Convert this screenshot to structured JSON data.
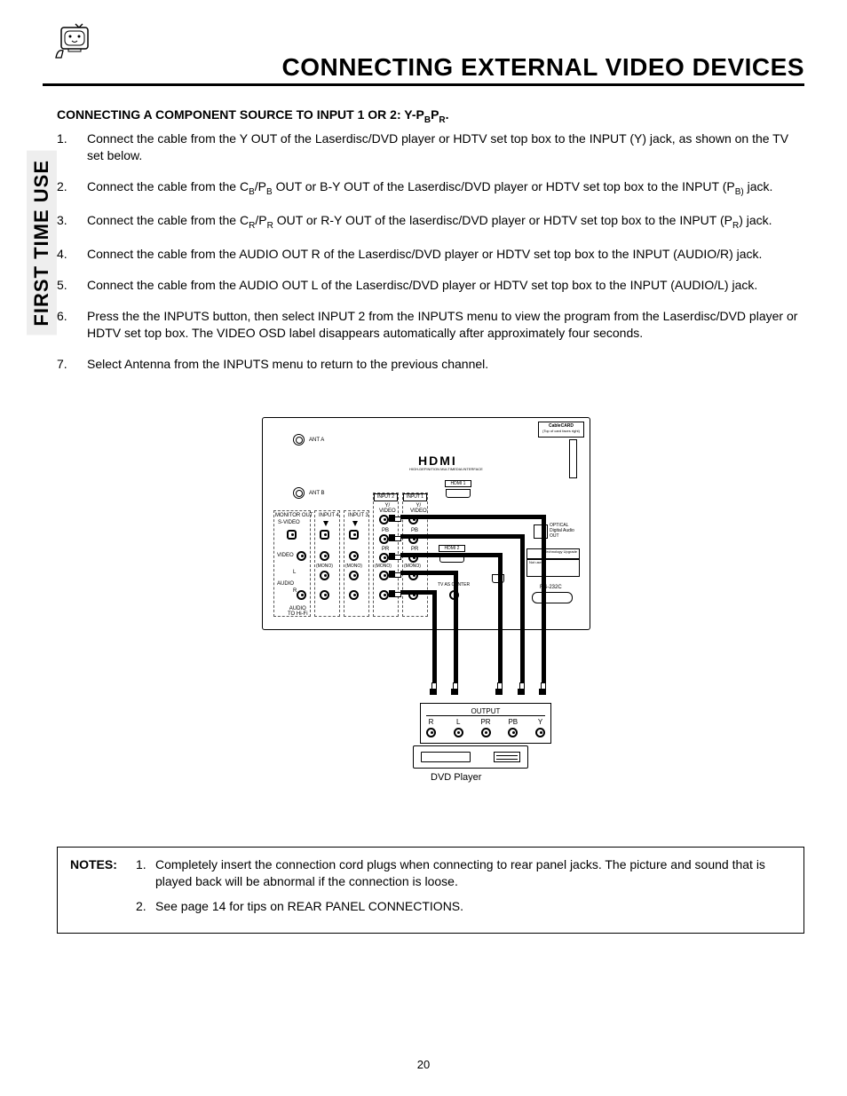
{
  "header": {
    "title": "CONNECTING EXTERNAL VIDEO DEVICES",
    "vertical_tab": "FIRST TIME USE"
  },
  "section": {
    "heading_pre": "CONNECTING A COMPONENT SOURCE TO INPUT 1 OR 2:  Y-P",
    "heading_sub1": "B",
    "heading_mid": "P",
    "heading_sub2": "R",
    "heading_post": "."
  },
  "steps": [
    {
      "num": "1.",
      "pre": "Connect the cable from the Y OUT of the Laserdisc/DVD player or HDTV set top box to the INPUT (Y) jack, as shown on the TV set below."
    },
    {
      "num": "2.",
      "pre": "Connect the cable from the C",
      "s1": "B",
      "m1": "/P",
      "s2": "B",
      "m2": " OUT or B-Y OUT of the Laserdisc/DVD  player or HDTV set top box to the INPUT (P",
      "s3": "B)",
      "post": " jack."
    },
    {
      "num": "3.",
      "pre": "Connect the cable from the C",
      "s1": "R",
      "m1": "/P",
      "s2": "R",
      "m2": " OUT or R-Y OUT of the laserdisc/DVD player or HDTV set top box to the INPUT (P",
      "s3": "R",
      "post": ") jack."
    },
    {
      "num": "4.",
      "pre": "Connect the cable from the AUDIO OUT R of the Laserdisc/DVD player or  HDTV set top box to the INPUT (AUDIO/R) jack."
    },
    {
      "num": "5.",
      "pre": "Connect the cable from the AUDIO OUT L of the Laserdisc/DVD player or HDTV set top box to the INPUT (AUDIO/L) jack."
    },
    {
      "num": "6.",
      "pre": "Press the the INPUTS button, then select INPUT 2 from the INPUTS menu to view the program from the Laserdisc/DVD player or HDTV set top box.  The VIDEO OSD label disappears automatically after approximately four seconds."
    },
    {
      "num": "7.",
      "pre": "Select Antenna from the INPUTS menu to return to the previous channel."
    }
  ],
  "diagram": {
    "ant_a": "ANT A",
    "ant_b": "ANT B",
    "hdmi_logo": "HDMI",
    "hdmi_tag": "HIGH-DEFINITION MULTIMEDIA INTERFACE",
    "cablecard": "CableCARD",
    "cablecard_sub": "(Top of card faces right)",
    "hdmi1": "HDMI 1",
    "hdmi2": "HDMI 2",
    "input1": "INPUT 1",
    "input2": "INPUT 2",
    "input3": "INPUT 3",
    "input4": "INPUT 4",
    "monitor_out": "MONITOR OUT",
    "svideo": "S-VIDEO",
    "video": "VIDEO",
    "y_video": "Y/\nVIDEO",
    "pb": "PB",
    "pr": "PR",
    "mono": "(MONO)",
    "audio": "AUDIO",
    "audio_to_hifi": "AUDIO\nTO Hi-Fi",
    "r": "R",
    "l": "L",
    "tv_as_center": "TV AS CENTER",
    "optical": "OPTICAL\nDigital Audio\nOUT",
    "upgrade": "UPGRADE",
    "rs232c": "RS-232C",
    "lan": "LAN",
    "output_hdr": "OUTPUT",
    "out_cols": [
      "R",
      "L",
      "PR",
      "PB",
      "Y"
    ],
    "device_label": "DVD Player"
  },
  "notes": {
    "label": "NOTES:",
    "items": [
      {
        "num": "1.",
        "text": "Completely insert the connection cord plugs when connecting to rear panel jacks.  The picture and sound that is played back will be abnormal if the connection is loose."
      },
      {
        "num": "2.",
        "text": "See page 14 for tips on REAR PANEL CONNECTIONS."
      }
    ]
  },
  "page_number": "20"
}
